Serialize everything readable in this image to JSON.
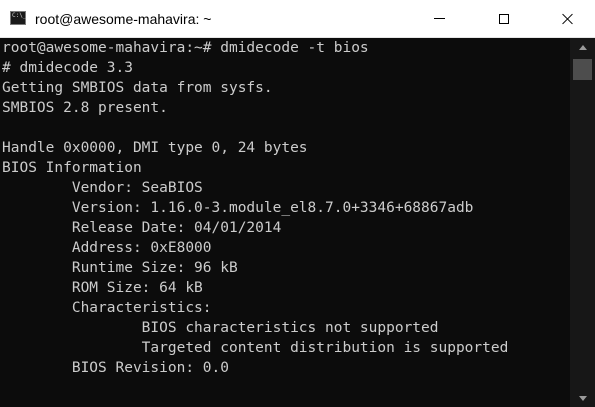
{
  "window": {
    "title": "root@awesome-mahavira: ~",
    "icon": "terminal-icon",
    "icon_glyph": "C:\\_"
  },
  "controls": {
    "minimize_icon": "minimize-icon",
    "maximize_icon": "maximize-icon",
    "close_icon": "close-icon"
  },
  "terminal": {
    "lines": [
      "root@awesome-mahavira:~# dmidecode -t bios",
      "# dmidecode 3.3",
      "Getting SMBIOS data from sysfs.",
      "SMBIOS 2.8 present.",
      "",
      "Handle 0x0000, DMI type 0, 24 bytes",
      "BIOS Information",
      "        Vendor: SeaBIOS",
      "        Version: 1.16.0-3.module_el8.7.0+3346+68867adb",
      "        Release Date: 04/01/2014",
      "        Address: 0xE8000",
      "        Runtime Size: 96 kB",
      "        ROM Size: 64 kB",
      "        Characteristics:",
      "                BIOS characteristics not supported",
      "                Targeted content distribution is supported",
      "        BIOS Revision: 0.0"
    ]
  },
  "colors": {
    "background": "#0c0c0c",
    "foreground": "#cccccc",
    "titlebar": "#ffffff"
  }
}
